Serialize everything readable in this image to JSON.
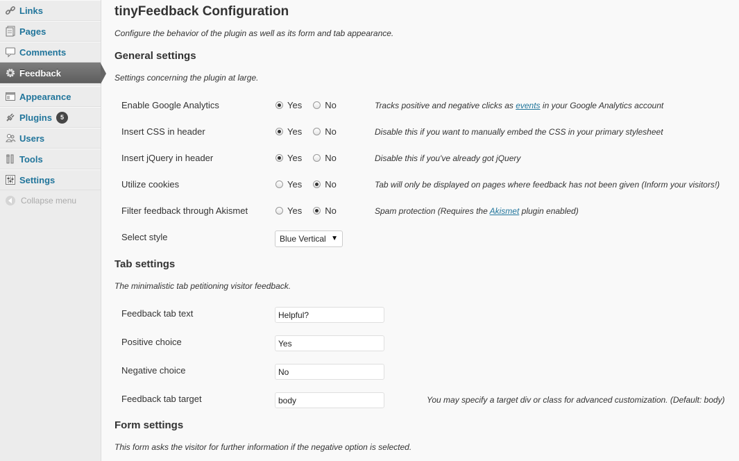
{
  "sidebar": {
    "items": [
      {
        "label": "Links",
        "icon": "link-icon",
        "current": false
      },
      {
        "label": "Pages",
        "icon": "pages-icon",
        "current": false
      },
      {
        "label": "Comments",
        "icon": "comments-icon",
        "current": false
      },
      {
        "label": "Feedback",
        "icon": "gear-icon",
        "current": true
      },
      {
        "label": "Appearance",
        "icon": "appearance-icon",
        "current": false
      },
      {
        "label": "Plugins",
        "icon": "plug-icon",
        "current": false,
        "badge": "5"
      },
      {
        "label": "Users",
        "icon": "users-icon",
        "current": false
      },
      {
        "label": "Tools",
        "icon": "tools-icon",
        "current": false
      },
      {
        "label": "Settings",
        "icon": "settings-icon",
        "current": false
      }
    ],
    "collapse_label": "Collapse menu"
  },
  "page": {
    "title": "tinyFeedback Configuration",
    "description": "Configure the behavior of the plugin as well as its form and tab appearance."
  },
  "general": {
    "heading": "General settings",
    "description": "Settings concerning the plugin at large.",
    "yes_label": "Yes",
    "no_label": "No",
    "rows": [
      {
        "label": "Enable Google Analytics",
        "value": "yes",
        "help_before": "Tracks positive and negative clicks as ",
        "help_link": "events",
        "help_after": " in your Google Analytics account"
      },
      {
        "label": "Insert CSS in header",
        "value": "yes",
        "help_before": "Disable this if you want to manually embed the CSS in your primary stylesheet",
        "help_link": "",
        "help_after": ""
      },
      {
        "label": "Insert jQuery in header",
        "value": "yes",
        "help_before": "Disable this if you've already got jQuery",
        "help_link": "",
        "help_after": ""
      },
      {
        "label": "Utilize cookies",
        "value": "no",
        "help_before": "Tab will only be displayed on pages where feedback has not been given (Inform your visitors!)",
        "help_link": "",
        "help_after": ""
      },
      {
        "label": "Filter feedback through Akismet",
        "value": "no",
        "help_before": "Spam protection (Requires the ",
        "help_link": "Akismet",
        "help_after": " plugin enabled)"
      }
    ],
    "style": {
      "label": "Select style",
      "value": "Blue Vertical"
    }
  },
  "tab": {
    "heading": "Tab settings",
    "description": "The minimalistic tab petitioning visitor feedback.",
    "fields": [
      {
        "label": "Feedback tab text",
        "value": "Helpful?"
      },
      {
        "label": "Positive choice",
        "value": "Yes"
      },
      {
        "label": "Negative choice",
        "value": "No"
      },
      {
        "label": "Feedback tab target",
        "value": "body"
      }
    ],
    "target_help": "You may specify a target div or class for advanced customization. (Default: body)"
  },
  "form": {
    "heading": "Form settings",
    "description": "This form asks the visitor for further information if the negative option is selected."
  },
  "colors": {
    "link": "#21759b",
    "current_menu": "#6d6d6d",
    "badge": "#464646"
  }
}
